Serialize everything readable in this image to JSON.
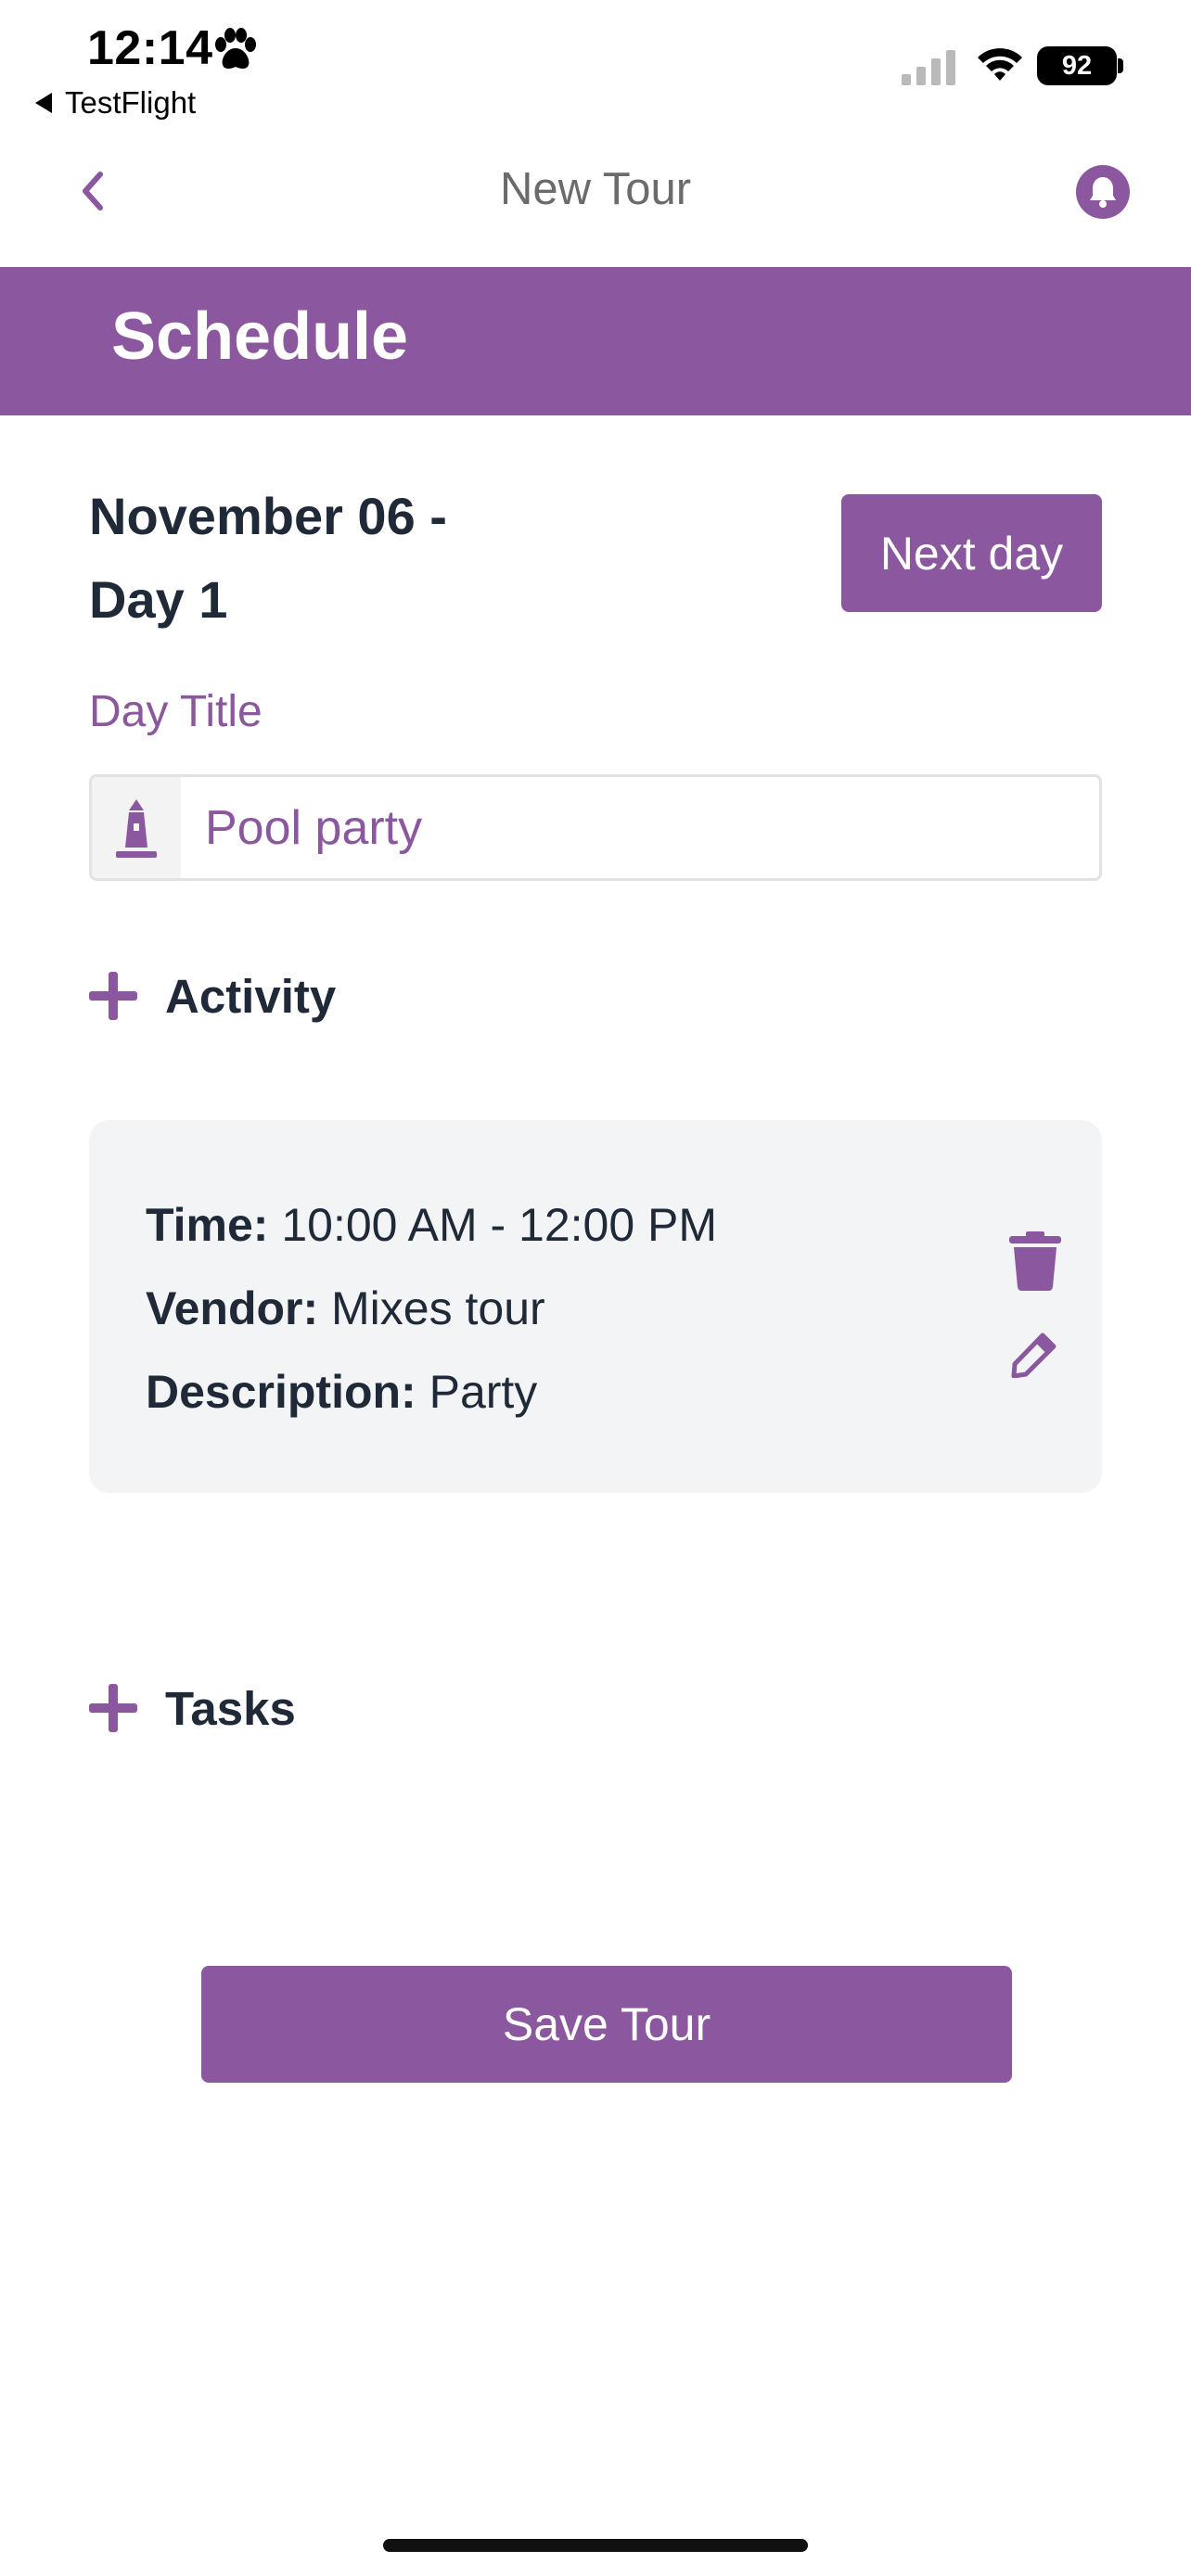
{
  "status_bar": {
    "time": "12:14",
    "back_app": "TestFlight",
    "battery": "92"
  },
  "nav": {
    "title": "New Tour"
  },
  "banner": {
    "title": "Schedule"
  },
  "day": {
    "title_line1": "November 06 -",
    "title_line2": "Day 1",
    "next_label": "Next day",
    "field_label": "Day Title",
    "field_value": "Pool party"
  },
  "activity": {
    "add_label": "Activity",
    "items": [
      {
        "time_label": "Time:",
        "time_value": "10:00 AM - 12:00 PM",
        "vendor_label": "Vendor:",
        "vendor_value": "Mixes tour",
        "description_label": "Description:",
        "description_value": "Party"
      }
    ]
  },
  "tasks": {
    "add_label": "Tasks"
  },
  "actions": {
    "save_label": "Save Tour"
  },
  "colors": {
    "accent": "#8b579e",
    "text_dark": "#1f2937",
    "card_bg": "#f3f4f5"
  }
}
